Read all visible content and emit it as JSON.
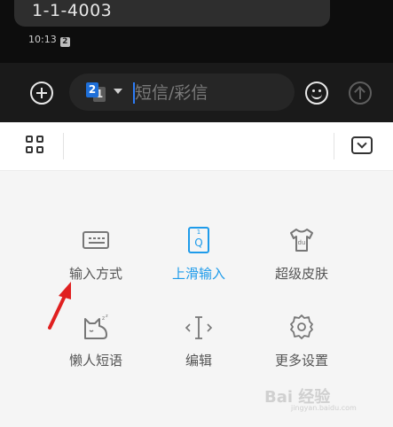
{
  "message": {
    "text": "1-1-4003",
    "time": "10:13",
    "sim_mark": "2"
  },
  "composer": {
    "sim_front": "2",
    "sim_back": "1",
    "placeholder": "短信/彩信"
  },
  "panel": {
    "items": [
      {
        "label": "输入方式",
        "icon": "keyboard-icon",
        "active": false
      },
      {
        "label": "上滑输入",
        "icon": "swipe-input-icon",
        "active": true,
        "icon_top_text": "1",
        "icon_main_text": "Q"
      },
      {
        "label": "超级皮肤",
        "icon": "skin-shirt-icon",
        "active": false,
        "icon_text": "du"
      },
      {
        "label": "懒人短语",
        "icon": "lazy-phrase-cat-icon",
        "active": false
      },
      {
        "label": "编辑",
        "icon": "edit-cursor-icon",
        "active": false
      },
      {
        "label": "更多设置",
        "icon": "gear-icon",
        "active": false
      }
    ]
  },
  "colors": {
    "active": "#1e9bea",
    "annotation_arrow": "#e02020",
    "send_disabled": "#5e5e5e",
    "cursor": "#2d7cf6"
  },
  "watermark": {
    "logo": "Bai 经验",
    "sub": "jingyan.baidu.com"
  }
}
